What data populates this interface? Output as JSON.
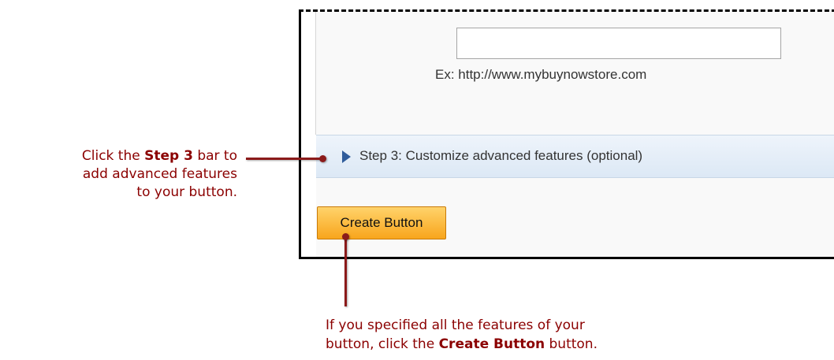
{
  "form": {
    "url_input": {
      "value": "",
      "placeholder": ""
    },
    "url_example": "Ex: http://www.mybuynowstore.com"
  },
  "step3_bar": {
    "icon": "triangle-right-icon",
    "label": "Step 3: Customize advanced features (optional)"
  },
  "create_button": {
    "label": "Create Button"
  },
  "annotations": {
    "left_callout": {
      "prefix": "Click the ",
      "bold": "Step 3",
      "suffix_line1": " bar to",
      "line2": "add advanced features",
      "line3": "to your button."
    },
    "bottom_callout": {
      "line1": "If you specified all the features of your",
      "line2_prefix": "button, click the ",
      "line2_bold": "Create Button",
      "line2_suffix": " button."
    }
  },
  "colors": {
    "annotation_text": "#8b0000",
    "annotation_arrow": "#8b1a1a",
    "button_orange": "#f8a51c",
    "step_bar_icon": "#2f5c9b"
  }
}
